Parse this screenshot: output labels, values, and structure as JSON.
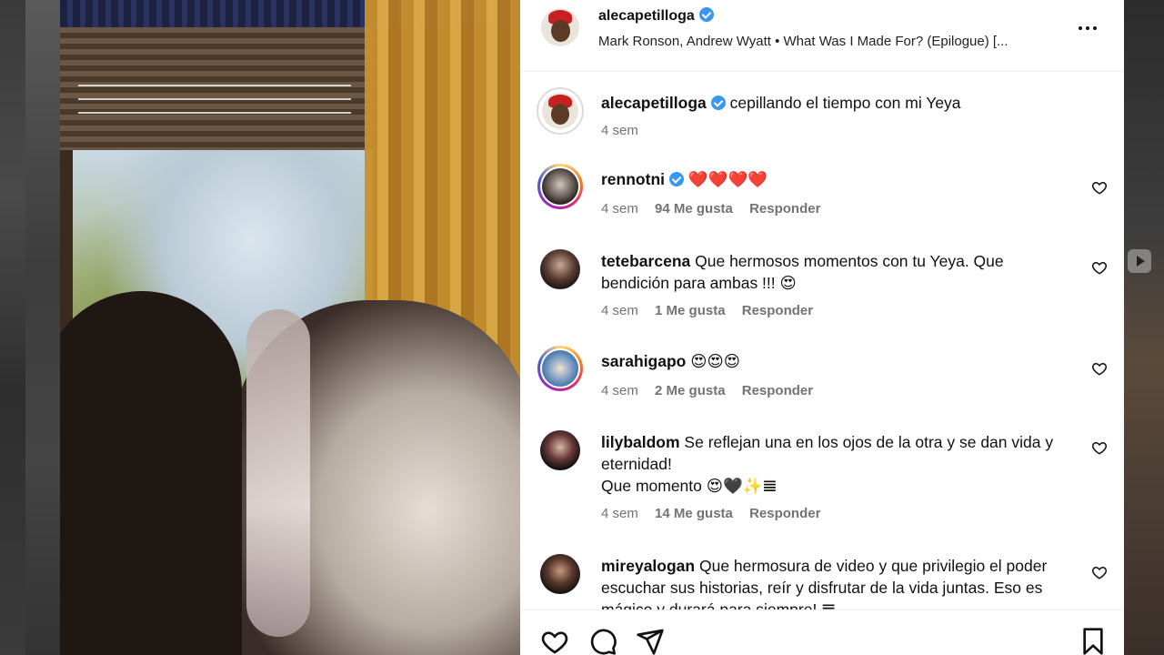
{
  "post": {
    "username": "alecapetilloga",
    "audio": "Mark Ronson, Andrew Wyatt • What Was I Made For? (Epilogue) [...",
    "caption": "cepillando el tiempo con mi Yeya",
    "caption_time": "4 sem"
  },
  "comments": [
    {
      "user": "rennotni",
      "verified": true,
      "text": "❤️❤️❤️❤️",
      "time": "4 sem",
      "likes": "94 Me gusta",
      "reply": "Responder"
    },
    {
      "user": "tetebarcena",
      "text": "Que hermosos momentos con tu Yeya. Que bendición para ambas !!! 😍",
      "time": "4 sem",
      "likes": "1 Me gusta",
      "reply": "Responder"
    },
    {
      "user": "sarahigapo",
      "text": "😍😍😍",
      "time": "4 sem",
      "likes": "2 Me gusta",
      "reply": "Responder"
    },
    {
      "user": "lilybaldom",
      "text": "Se reflejan una en los ojos de la otra y se dan vida y eternidad!",
      "text2": "Que momento 😍🖤✨𝌆",
      "time": "4 sem",
      "likes": "14 Me gusta",
      "reply": "Responder"
    },
    {
      "user": "mireyalogan",
      "text": "Que hermosura de video y que privilegio el poder escuchar sus historias, reír y disfrutar de la vida juntas. Eso es mágico y durará para siempre! 𝌆"
    }
  ],
  "icons": {
    "more": "more-horizontal-icon",
    "like": "heart-icon",
    "comment": "comment-bubble-icon",
    "share": "paper-plane-icon",
    "save": "bookmark-icon",
    "verified": "verified-badge-icon"
  },
  "colors": {
    "verified": "#3897f0",
    "meta": "#737373",
    "text": "#111111"
  }
}
